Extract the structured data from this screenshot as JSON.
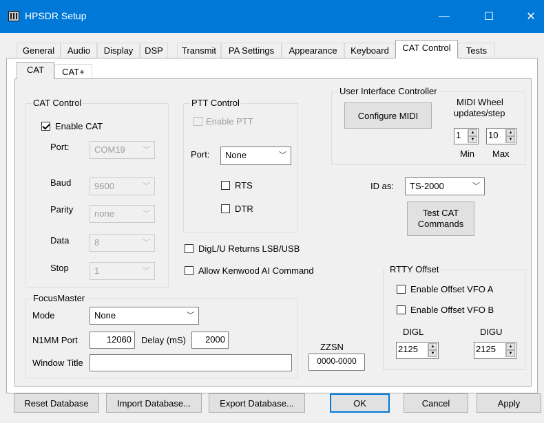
{
  "window": {
    "title": "HPSDR Setup",
    "minimize": "—",
    "maximize": "☐",
    "close": "✕"
  },
  "tabs": [
    "General",
    "Audio",
    "Display",
    "DSP",
    "Transmit",
    "PA Settings",
    "Appearance",
    "Keyboard",
    "CAT Control",
    "Tests"
  ],
  "active_tab": "CAT Control",
  "subtabs": [
    "CAT",
    "CAT+"
  ],
  "cat_control": {
    "legend": "CAT Control",
    "enable_cat": {
      "label": "Enable CAT",
      "checked": true
    },
    "port": {
      "label": "Port:",
      "value": "COM19"
    },
    "baud": {
      "label": "Baud",
      "value": "9600"
    },
    "parity": {
      "label": "Parity",
      "value": "none"
    },
    "data": {
      "label": "Data",
      "value": "8"
    },
    "stop": {
      "label": "Stop",
      "value": "1"
    }
  },
  "ptt_control": {
    "legend": "PTT Control",
    "enable_ptt": {
      "label": "Enable PTT",
      "checked": false
    },
    "port": {
      "label": "Port:",
      "value": "None"
    },
    "rts": {
      "label": "RTS",
      "checked": false
    },
    "dtr": {
      "label": "DTR",
      "checked": false
    }
  },
  "ui_controller": {
    "legend": "User Interface Controller",
    "configure_midi": "Configure MIDI",
    "midi_wheel_line1": "MIDI Wheel",
    "midi_wheel_line2": "updates/step",
    "min_value": "1",
    "max_value": "10",
    "min_label": "Min",
    "max_label": "Max"
  },
  "id_as": {
    "label": "ID as:",
    "value": "TS-2000"
  },
  "test_cat": {
    "line1": "Test CAT",
    "line2": "Commands"
  },
  "digl_returns": {
    "label": "DigL/U Returns LSB/USB",
    "checked": false
  },
  "allow_kenwood": {
    "label": "Allow Kenwood AI Command",
    "checked": false
  },
  "focusmaster": {
    "legend": "FocusMaster",
    "mode_label": "Mode",
    "mode_value": "None",
    "n1mm_label": "N1MM Port",
    "n1mm_value": "12060",
    "delay_label": "Delay (mS)",
    "delay_value": "2000",
    "window_title_label": "Window Title",
    "window_title_value": ""
  },
  "zzsn": {
    "label": "ZZSN",
    "value": "0000-0000"
  },
  "rtty_offset": {
    "legend": "RTTY Offset",
    "enable_vfo_a": {
      "label": "Enable Offset VFO A",
      "checked": false
    },
    "enable_vfo_b": {
      "label": "Enable Offset VFO B",
      "checked": false
    },
    "digl_label": "DIGL",
    "digu_label": "DIGU",
    "digl_value": "2125",
    "digu_value": "2125"
  },
  "bottom_buttons": {
    "reset": "Reset Database",
    "import": "Import Database...",
    "export": "Export Database...",
    "ok": "OK",
    "cancel": "Cancel",
    "apply": "Apply"
  },
  "colors": {
    "titlebar": "#0078d7",
    "dialog_bg": "#f0f0f0",
    "default_button_border": "#0078d7"
  },
  "icons": {
    "app": "radio-app-icon",
    "spin_up": "spin-up-icon",
    "spin_down": "spin-down-icon",
    "dropdown": "chevron-down-icon"
  }
}
